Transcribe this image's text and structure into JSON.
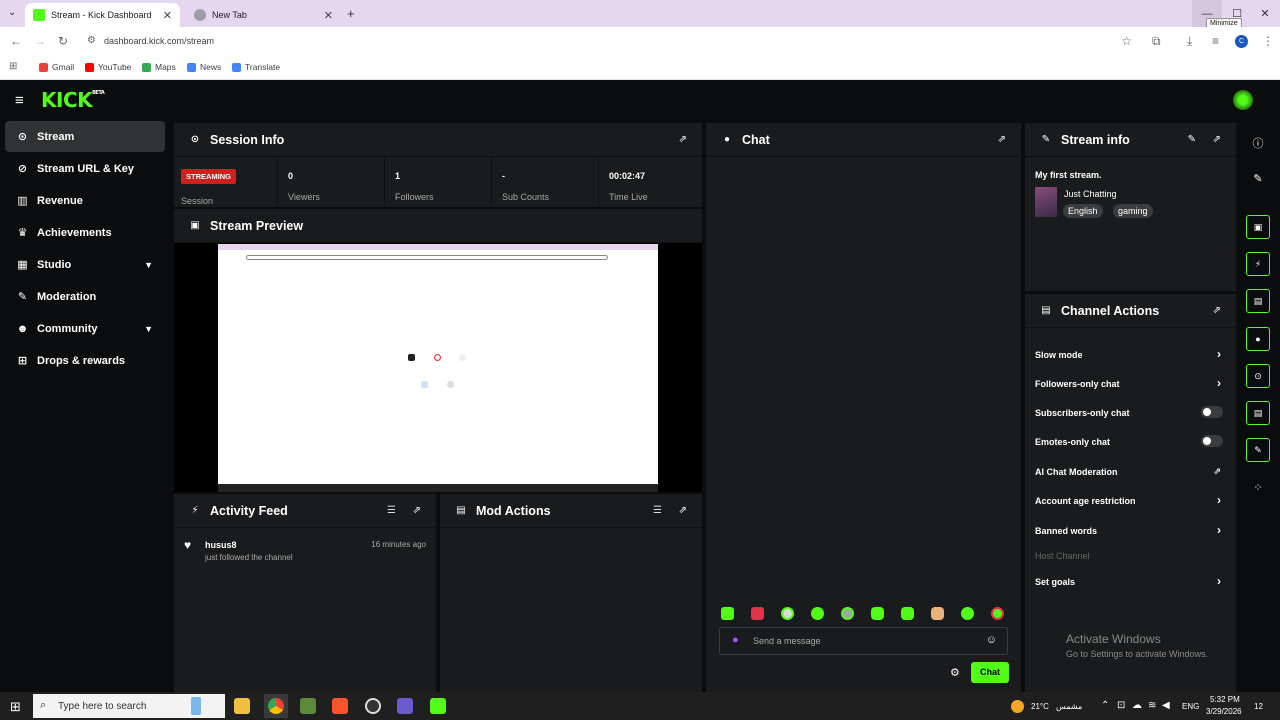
{
  "browser": {
    "tabs": [
      {
        "title": "Stream - Kick Dashboard",
        "active": true
      },
      {
        "title": "New Tab",
        "active": false
      }
    ],
    "tooltip": "Minimize",
    "url": "dashboard.kick.com/stream",
    "bookmarks": [
      "Gmail",
      "YouTube",
      "Maps",
      "News",
      "Translate"
    ],
    "profile_initial": "C"
  },
  "brand": {
    "logo": "KICK",
    "beta": "BETA",
    "accent": "#53fc18"
  },
  "sidebar": {
    "items": [
      {
        "label": "Stream",
        "icon": "broadcast-icon",
        "active": true
      },
      {
        "label": "Stream URL & Key",
        "icon": "link-icon"
      },
      {
        "label": "Revenue",
        "icon": "chart-icon"
      },
      {
        "label": "Achievements",
        "icon": "trophy-icon"
      },
      {
        "label": "Studio",
        "icon": "studio-icon",
        "expandable": true
      },
      {
        "label": "Moderation",
        "icon": "wrench-icon"
      },
      {
        "label": "Community",
        "icon": "people-icon",
        "expandable": true
      },
      {
        "label": "Drops & rewards",
        "icon": "gift-icon"
      }
    ]
  },
  "session": {
    "title": "Session Info",
    "status_badge": "STREAMING",
    "status_label": "Session",
    "stats": [
      {
        "value": "0",
        "label": "Viewers"
      },
      {
        "value": "1",
        "label": "Followers"
      },
      {
        "value": "-",
        "label": "Sub Counts"
      },
      {
        "value": "00:02:47",
        "label": "Time Live"
      }
    ]
  },
  "preview": {
    "title": "Stream Preview"
  },
  "activity": {
    "title": "Activity Feed",
    "items": [
      {
        "user": "husus8",
        "text": "just followed the channel",
        "time": "16 minutes ago"
      }
    ]
  },
  "mod_actions": {
    "title": "Mod Actions"
  },
  "chat": {
    "title": "Chat",
    "placeholder": "Send a message",
    "send_label": "Chat"
  },
  "stream_info": {
    "title": "Stream info",
    "stream_title": "My first stream.",
    "category": "Just Chatting",
    "tags": [
      "English",
      "gaming"
    ]
  },
  "channel_actions": {
    "title": "Channel Actions",
    "items": [
      {
        "label": "Slow mode",
        "control": "arrow"
      },
      {
        "label": "Followers-only chat",
        "control": "arrow"
      },
      {
        "label": "Subscribers-only chat",
        "control": "toggle"
      },
      {
        "label": "Emotes-only chat",
        "control": "toggle"
      },
      {
        "label": "AI Chat Moderation",
        "control": "external"
      },
      {
        "label": "Account age restriction",
        "control": "arrow"
      },
      {
        "label": "Banned words",
        "control": "arrow"
      },
      {
        "label": "Host Channel",
        "control": "none",
        "disabled": true
      },
      {
        "label": "Set goals",
        "control": "arrow"
      }
    ]
  },
  "watermark": {
    "line1": "Activate Windows",
    "line2": "Go to Settings to activate Windows."
  },
  "taskbar": {
    "search_placeholder": "Type here to search",
    "weather": "21°C",
    "weather_desc": "مشمس",
    "lang": "ENG",
    "time": "5:32 PM",
    "date": "3/29/2026",
    "notifications": "12"
  }
}
